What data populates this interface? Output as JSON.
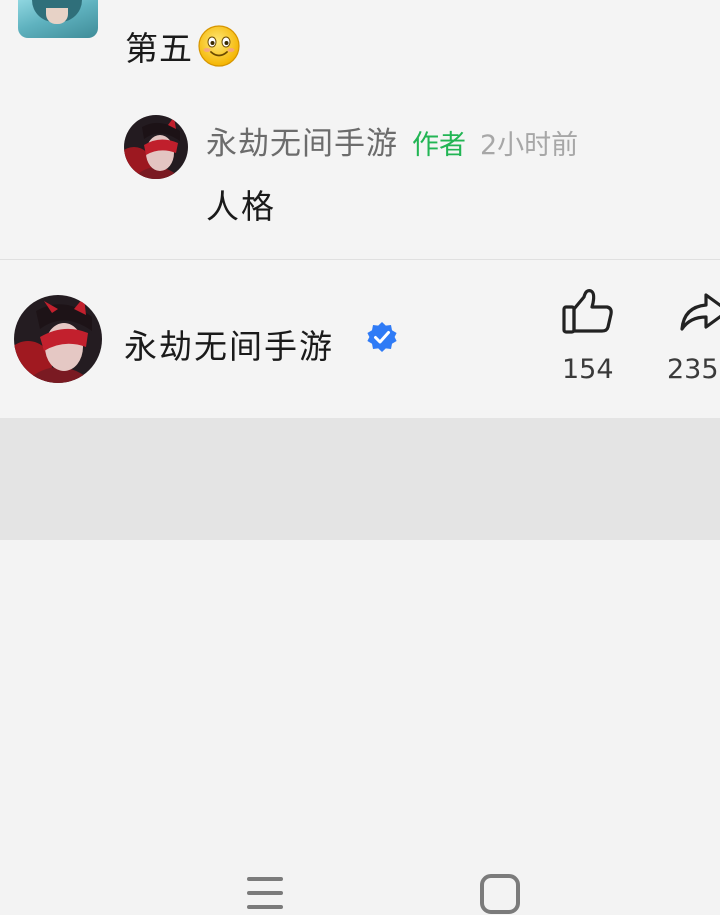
{
  "colors": {
    "author_tag": "#22b554",
    "verified": "#2f7bf6",
    "meta_gray": "#a7a7a7",
    "navbar_bg": "#e4e4e4"
  },
  "comment": {
    "text": "第五",
    "emoji": "smiling-face-emoji"
  },
  "reply": {
    "username": "永劫无间手游",
    "author_tag": "作者",
    "time": "2小时前",
    "text": "人格"
  },
  "footer": {
    "author_name": "永劫无间手游",
    "verified_icon": "verified-badge-icon",
    "likes": "154",
    "shares": "235"
  },
  "navbar": {
    "icons": [
      "menu-icon",
      "home-icon"
    ]
  }
}
